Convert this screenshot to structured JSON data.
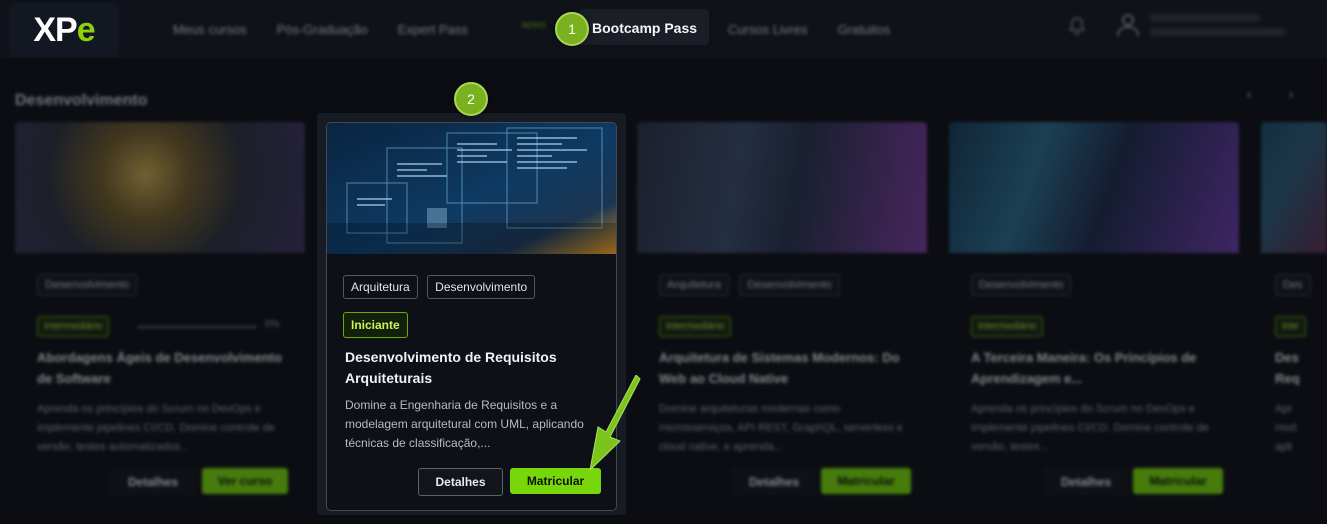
{
  "brand": {
    "logo": {
      "x": "X",
      "p": "P",
      "e": "e"
    }
  },
  "nav": {
    "items": [
      "Meus cursos",
      "Pós-Graduação",
      "Expert Pass"
    ],
    "badge": "NOVO",
    "active": "Bootcamp Pass",
    "items_right": [
      "Cursos Livres",
      "Gratuitos"
    ]
  },
  "markers": {
    "m1": "1",
    "m2": "2"
  },
  "icons": {
    "bell": "bell-icon",
    "user": "user-icon",
    "prev": "chevron-left-icon",
    "next": "chevron-right-icon"
  },
  "section": {
    "title": "Desenvolvimento"
  },
  "cards": [
    {
      "tags": [
        "Desenvolvimento"
      ],
      "level": "Intermediário",
      "progress": 0,
      "progress_text": "0%",
      "title": "Abordagens Ágeis de Desenvolvimento de Software",
      "desc": "Aprenda os princípios do Scrum no DevOps e implemente pipelines CI/CD. Domine controle de versão, testes automatizados...",
      "btn_details": "Detalhes",
      "btn_primary": "Ver curso"
    },
    {
      "tags": [
        "Arquitetura",
        "Desenvolvimento"
      ],
      "level": "Iniciante",
      "title": "Desenvolvimento de Requisitos Arquiteturais",
      "desc": "Domine a Engenharia de Requisitos e a modelagem arquitetural com UML, aplicando técnicas de classificação,...",
      "btn_details": "Detalhes",
      "btn_primary": "Matricular"
    },
    {
      "tags": [
        "Arquitetura",
        "Desenvolvimento"
      ],
      "level": "Intermediário",
      "title": "Arquitetura de Sistemas Modernos: Do Web ao Cloud Native",
      "desc": "Domine arquiteturas modernas como microsserviços, API REST, GraphQL, serverless e cloud native, e aprenda...",
      "btn_details": "Detalhes",
      "btn_primary": "Matricular"
    },
    {
      "tags": [
        "Desenvolvimento"
      ],
      "level": "Intermediário",
      "title": "A Terceira Maneira: Os Princípios de Aprendizagem e...",
      "desc": "Aprenda os princípios do Scrum no DevOps e implemente pipelines CI/CD. Domine controle de versão, testes...",
      "btn_details": "Detalhes",
      "btn_primary": "Matricular"
    },
    {
      "tags": [
        "Des"
      ],
      "level": "Inte",
      "title": "Des Req",
      "desc": "Apr mod apli",
      "btn_details": "",
      "btn_primary": ""
    }
  ],
  "colors": {
    "accent": "#78d70a",
    "background": "#0b0d12",
    "marker": "#7ab21f"
  }
}
